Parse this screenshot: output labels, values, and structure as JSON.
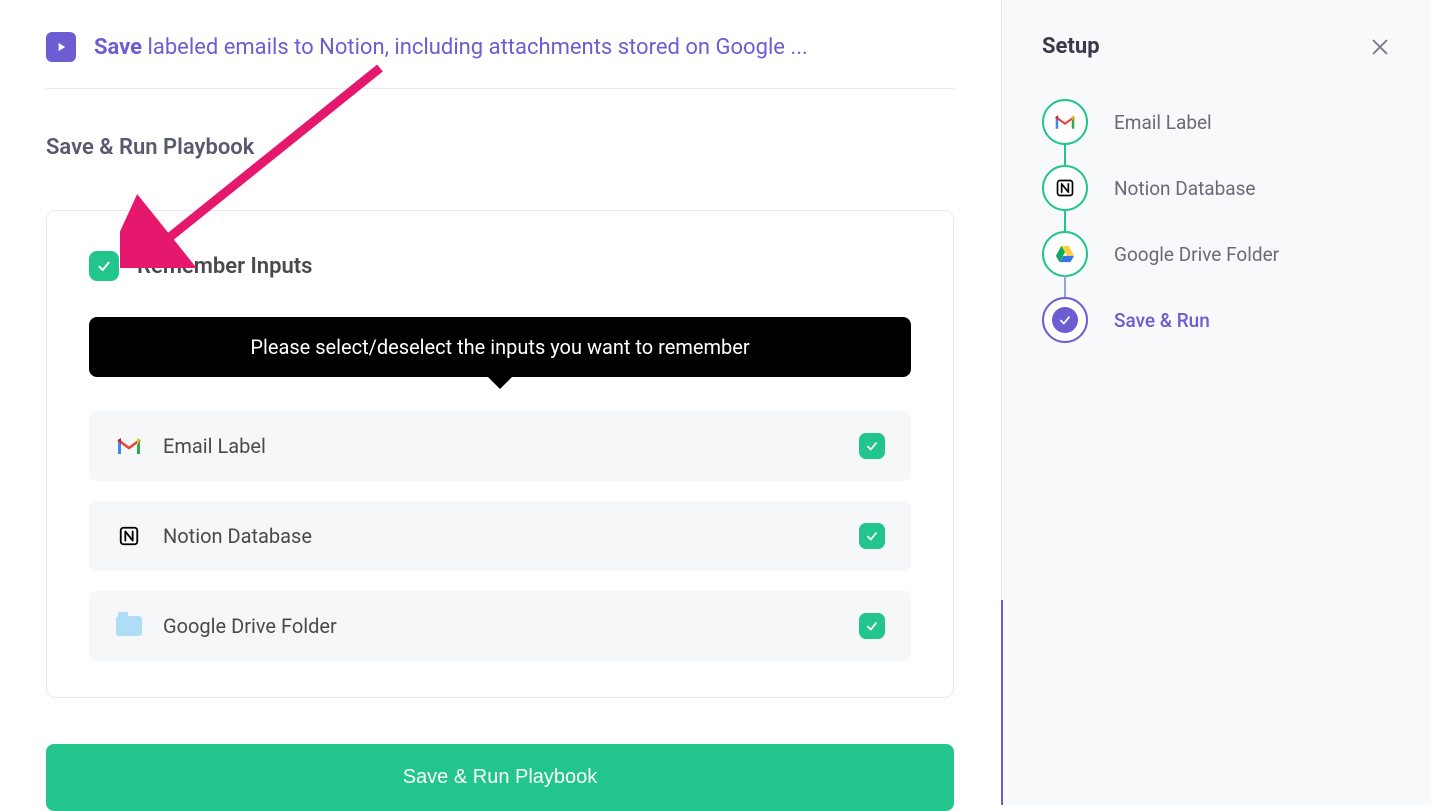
{
  "header": {
    "title_bold": "Save",
    "title_rest": " labeled emails to Notion, including attachments stored on Google ..."
  },
  "section_title": "Save & Run Playbook",
  "remember": {
    "label": "Remember Inputs",
    "checked": true
  },
  "tooltip": "Please select/deselect the inputs you want to remember",
  "inputs": [
    {
      "label": "Email Label",
      "icon": "gmail",
      "checked": true
    },
    {
      "label": "Notion Database",
      "icon": "notion",
      "checked": true
    },
    {
      "label": "Google Drive Folder",
      "icon": "folder",
      "checked": true
    }
  ],
  "save_run_button": "Save & Run Playbook",
  "sidebar": {
    "title": "Setup",
    "steps": [
      {
        "label": "Email Label",
        "icon": "gmail",
        "state": "done"
      },
      {
        "label": "Notion Database",
        "icon": "notion",
        "state": "done"
      },
      {
        "label": "Google Drive Folder",
        "icon": "gdrive",
        "state": "done"
      },
      {
        "label": "Save & Run",
        "icon": "check",
        "state": "active"
      }
    ]
  },
  "colors": {
    "accent": "#6d5dd3",
    "success": "#22c58b"
  }
}
